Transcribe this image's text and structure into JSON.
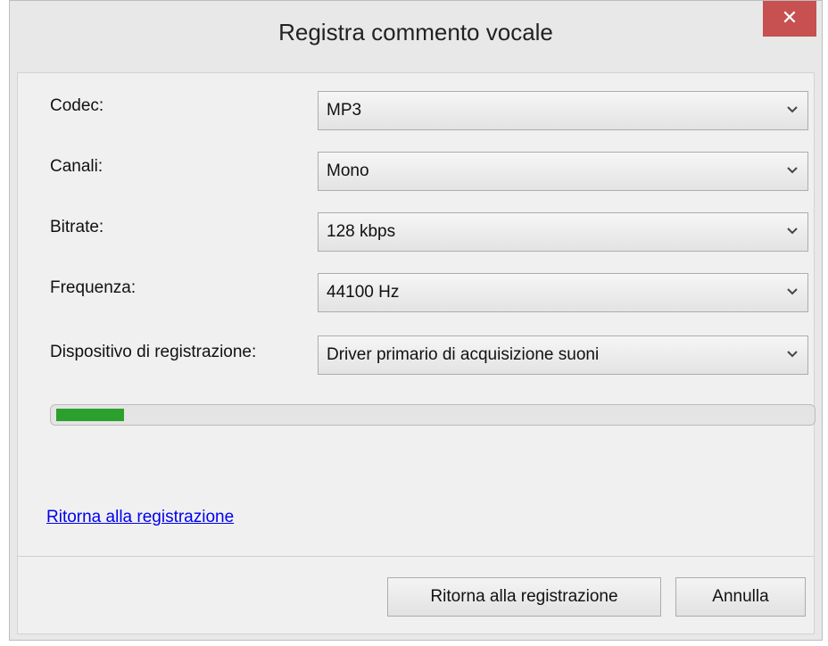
{
  "window": {
    "title": "Registra commento vocale",
    "close_glyph": "✕"
  },
  "fields": [
    {
      "label": "Codec:",
      "value": "MP3"
    },
    {
      "label": "Canali:",
      "value": "Mono"
    },
    {
      "label": "Bitrate:",
      "value": "128 kbps"
    },
    {
      "label": "Frequenza:",
      "value": "44100 Hz"
    },
    {
      "label": "Dispositivo di registrazione:",
      "value": "Driver primario di acquisizione suoni"
    }
  ],
  "progress": {
    "level_percent": 9,
    "color": "#2ca02c"
  },
  "link_text": "Ritorna alla registrazione",
  "buttons": {
    "primary": "Ritorna alla registrazione",
    "cancel": "Annulla"
  },
  "icons": {
    "close": "close-icon",
    "dropdown": "chevron-down-icon"
  }
}
